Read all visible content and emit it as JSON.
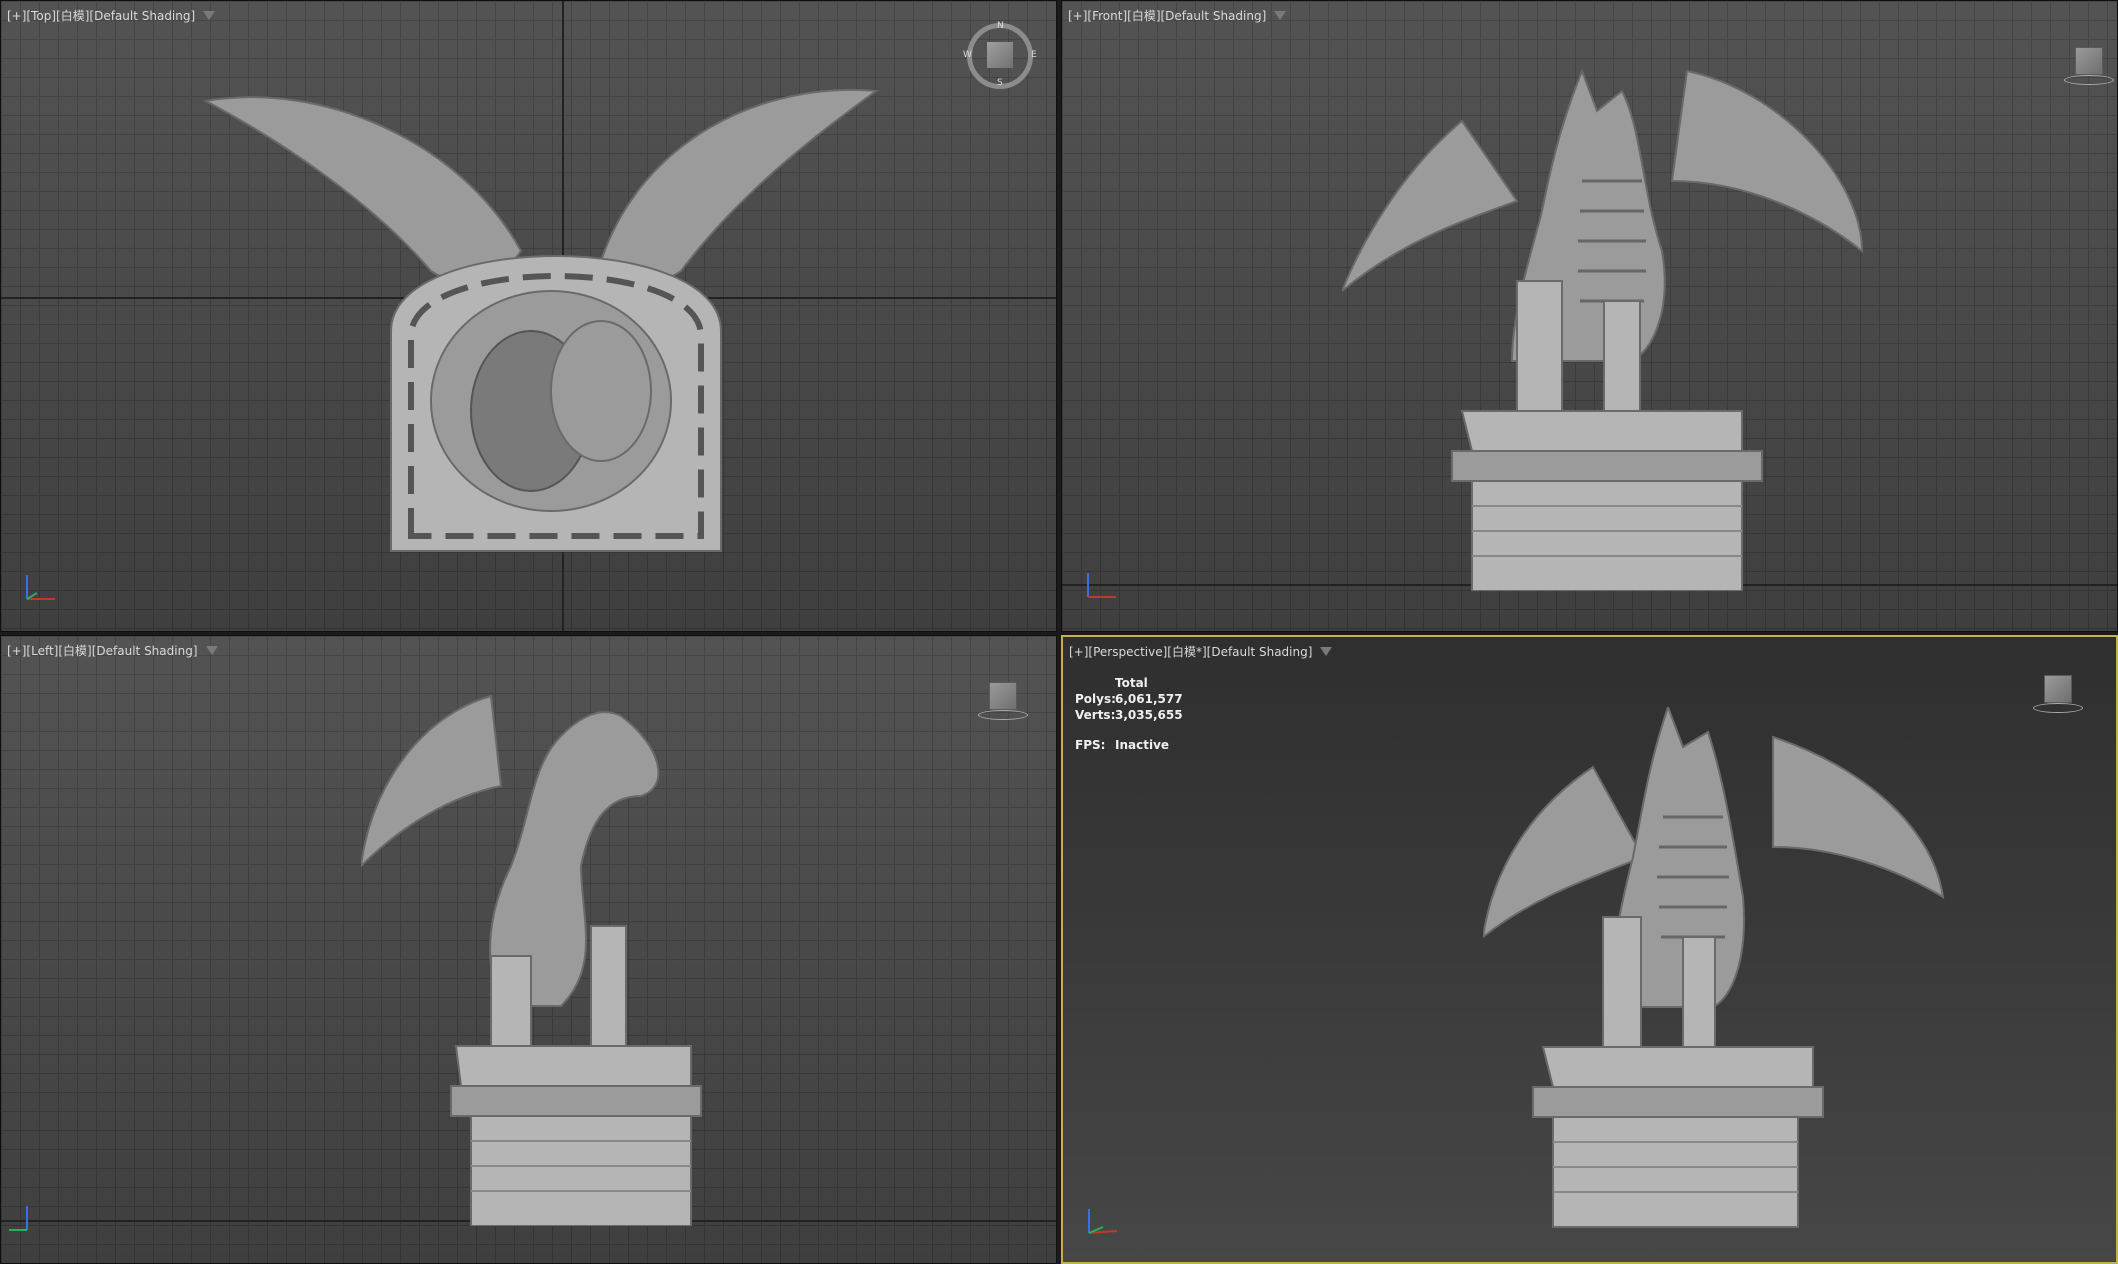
{
  "viewports": {
    "top": {
      "label": "[+][Top][白模][Default Shading]",
      "compass": {
        "n": "N",
        "s": "S",
        "w": "W",
        "e": "E"
      }
    },
    "front": {
      "label": "[+][Front][白模][Default Shading]"
    },
    "left": {
      "label": "[+][Left][白模][Default Shading]"
    },
    "perspective": {
      "label": "[+][Perspective][白模*][Default Shading]",
      "stats": {
        "header": "Total",
        "polys_label": "Polys:",
        "polys_value": "6,061,577",
        "verts_label": "Verts:",
        "verts_value": "3,035,655",
        "fps_label": "FPS:",
        "fps_value": "Inactive"
      }
    }
  },
  "colors": {
    "active_border": "#c7b04c",
    "x_axis": "#c0392b",
    "y_axis": "#27ae60",
    "z_axis": "#3a6ee8"
  },
  "icons": [
    "filter-icon",
    "viewcube-icon",
    "compass-icon",
    "axis-gizmo-icon"
  ]
}
